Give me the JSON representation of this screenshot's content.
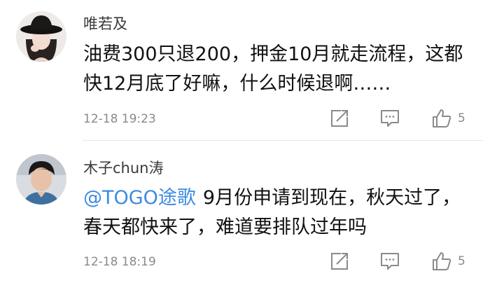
{
  "comments": [
    {
      "username": "唯若及",
      "text": "油费300只退200，押金10月就走流程，这都快12月底了好嘛，什么时候退啊……",
      "mention": "",
      "time": "12-18 19:23",
      "like_count": "5",
      "avatar_icon": "avatar-woman-black-hat"
    },
    {
      "username": "木子chun涛",
      "mention": "@TOGO途歌",
      "text": "9月份申请到现在，秋天过了，春天都快来了，难道要排队过年吗",
      "time": "12-18 18:19",
      "like_count": "5",
      "avatar_icon": "avatar-young-man"
    }
  ],
  "icons": {
    "share": "share-icon",
    "reply": "reply-icon",
    "like": "thumbs-up-icon"
  },
  "colors": {
    "mention": "#3d8ae3",
    "meta": "#8a8a8a",
    "text": "#111111"
  }
}
